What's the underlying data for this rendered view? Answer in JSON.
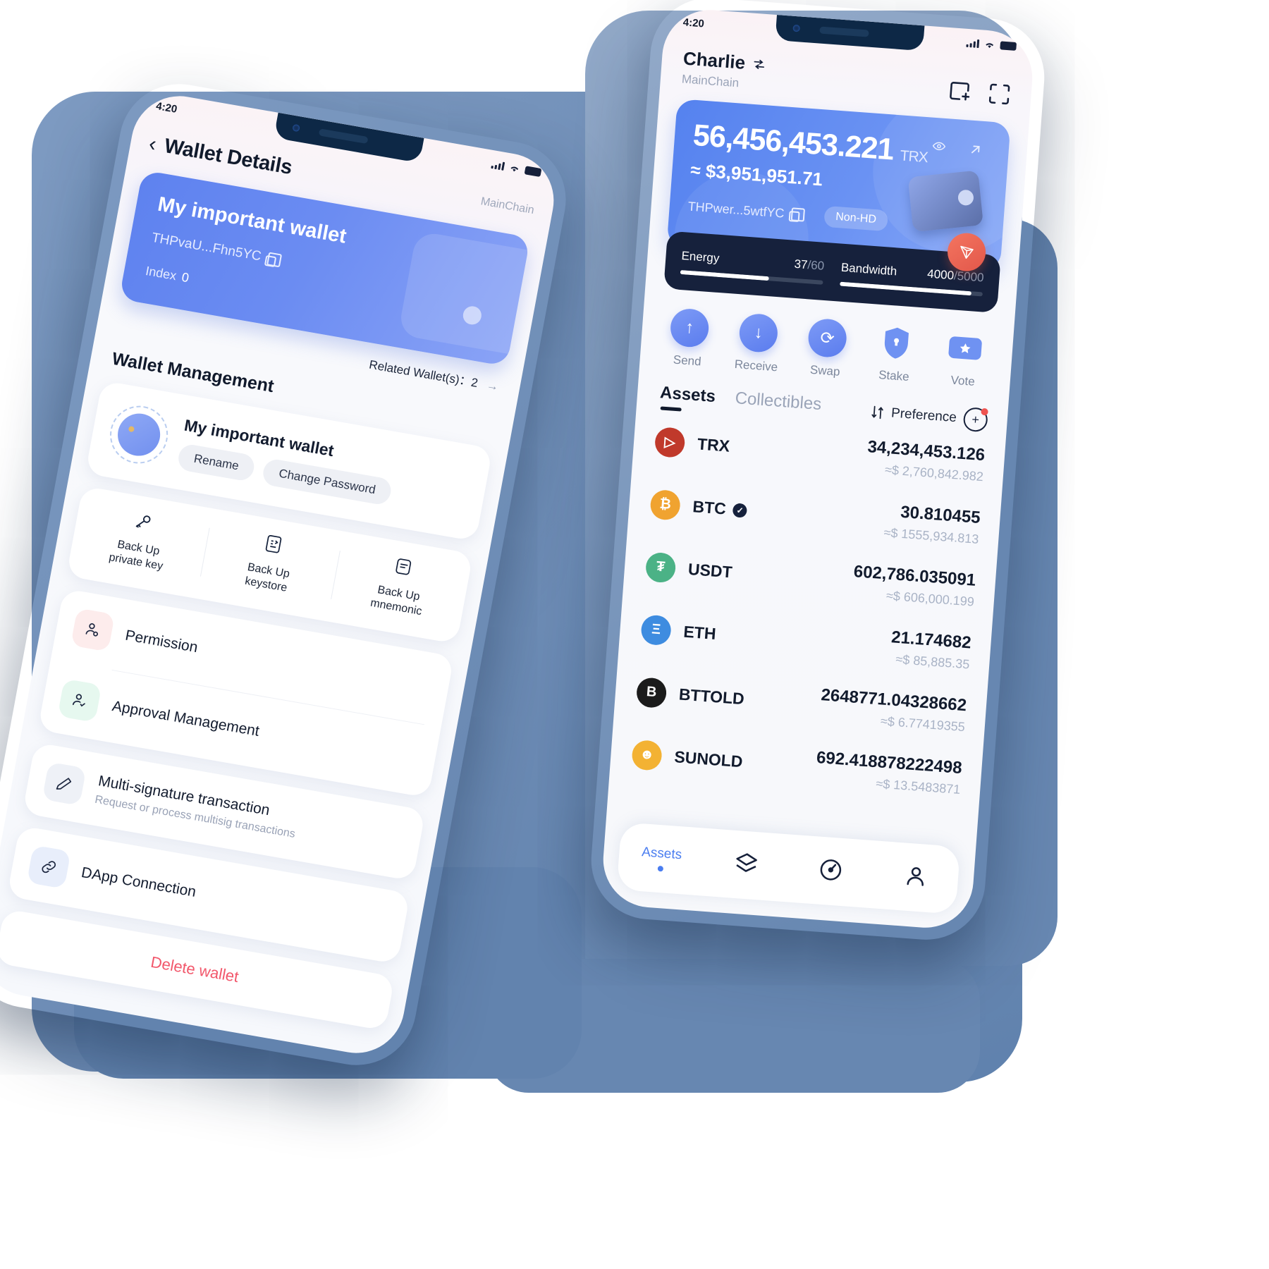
{
  "left_phone": {
    "status": {
      "time": "4:20"
    },
    "nav": {
      "back_icon": "chevron-left-icon",
      "title": "Wallet Details",
      "chain": "MainChain"
    },
    "wallet_card": {
      "name": "My important wallet",
      "address": "THPvaU...Fhn5YC",
      "copy_icon": "copy-icon",
      "index_label": "Index",
      "index_value": "0"
    },
    "related": {
      "label": "Related Wallet(s)：2",
      "arrow": "→"
    },
    "section_title": "Wallet Management",
    "wallet_row": {
      "name": "My important wallet",
      "rename_label": "Rename",
      "change_password_label": "Change Password"
    },
    "backups": [
      {
        "icon": "key-icon",
        "label": "Back Up\nprivate key"
      },
      {
        "icon": "keystore-icon",
        "label": "Back Up\nkeystore"
      },
      {
        "icon": "mnemonic-icon",
        "label": "Back Up\nmnemonic"
      }
    ],
    "menu": [
      {
        "icon": "permission-user-icon",
        "title": "Permission",
        "sub": "",
        "tint": "#fdecec"
      },
      {
        "icon": "approval-user-icon",
        "title": "Approval Management",
        "sub": "",
        "tint": "#e6f8ef"
      },
      {
        "icon": "pen-icon",
        "title": "Multi-signature transaction",
        "sub": "Request or process multisig transactions",
        "tint": "#eef1f7"
      },
      {
        "icon": "link-icon",
        "title": "DApp Connection",
        "sub": "",
        "tint": "#e8eefb"
      }
    ],
    "delete_label": "Delete wallet"
  },
  "right_phone": {
    "status": {
      "time": "4:20"
    },
    "header": {
      "account": "Charlie",
      "switch_icon": "switch-icon",
      "chain": "MainChain",
      "add_icon": "add-wallet-icon",
      "scan_icon": "scan-icon"
    },
    "balance": {
      "amount": "56,456,453.221",
      "symbol": "TRX",
      "fiat": "≈ $3,951,951.71",
      "address": "THPwer...5wtfYC",
      "copy_icon": "copy-icon",
      "hd_tag": "Non-HD",
      "eye_icon": "eye-icon",
      "open_icon": "arrow-up-right-icon",
      "wallet_art": "wallet-3d-icon"
    },
    "resources": [
      {
        "label": "Energy",
        "used": "37",
        "total": "60",
        "percent": 62
      },
      {
        "label": "Bandwidth",
        "used": "4000",
        "total": "5000",
        "percent": 80
      }
    ],
    "quick_actions": [
      {
        "icon": "arrow-up-icon",
        "label": "Send"
      },
      {
        "icon": "arrow-down-icon",
        "label": "Receive"
      },
      {
        "icon": "swap-icon",
        "label": "Swap"
      },
      {
        "icon": "shield-icon",
        "label": "Stake"
      },
      {
        "icon": "ticket-icon",
        "label": "Vote"
      }
    ],
    "tabs": [
      {
        "label": "Assets",
        "active": true
      },
      {
        "label": "Collectibles",
        "active": false
      }
    ],
    "preference": {
      "sort_icon": "sort-icon",
      "label": "Preference",
      "add_icon": "add-token-icon"
    },
    "assets": [
      {
        "symbol": "TRX",
        "verified": false,
        "balance": "34,234,453.126",
        "fiat": "≈$ 2,760,842.982",
        "color": "#c0392b",
        "glyph": "▷"
      },
      {
        "symbol": "BTC",
        "verified": true,
        "balance": "30.810455",
        "fiat": "≈$ 1555,934.813",
        "color": "#f0a330",
        "glyph": "₿"
      },
      {
        "symbol": "USDT",
        "verified": false,
        "balance": "602,786.035091",
        "fiat": "≈$ 606,000.199",
        "color": "#4bb286",
        "glyph": "₮"
      },
      {
        "symbol": "ETH",
        "verified": false,
        "balance": "21.174682",
        "fiat": "≈$ 85,885.35",
        "color": "#3e8ce0",
        "glyph": "Ξ"
      },
      {
        "symbol": "BTTOLD",
        "verified": false,
        "balance": "2648771.04328662",
        "fiat": "≈$ 6.77419355",
        "color": "#1b1b1b",
        "glyph": "B"
      },
      {
        "symbol": "SUNOLD",
        "verified": false,
        "balance": "692.418878222498",
        "fiat": "≈$ 13.5483871",
        "color": "#f3b233",
        "glyph": "☻"
      }
    ],
    "bottom_nav": [
      {
        "icon": "assets-icon",
        "label": "Assets",
        "active": true
      },
      {
        "icon": "layers-icon",
        "label": "",
        "active": false
      },
      {
        "icon": "explore-icon",
        "label": "",
        "active": false
      },
      {
        "icon": "profile-icon",
        "label": "",
        "active": false
      }
    ]
  },
  "colors": {
    "accent": "#5a7cee",
    "danger": "#f2576b",
    "dark": "#16213c",
    "backdrop": "#6d8cb5"
  }
}
